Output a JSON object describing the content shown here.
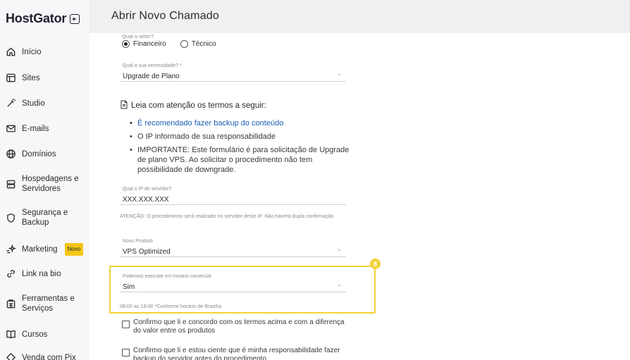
{
  "brand": {
    "name": "HostGator"
  },
  "sidebar": {
    "items": [
      {
        "label": "Início",
        "icon": "home-icon"
      },
      {
        "label": "Sites",
        "icon": "browser-icon"
      },
      {
        "label": "Studio",
        "icon": "wand-icon"
      },
      {
        "label": "E-mails",
        "icon": "mail-icon"
      },
      {
        "label": "Domínios",
        "icon": "globe-icon"
      },
      {
        "label": "Hospedagens e Servidores",
        "icon": "server-icon"
      },
      {
        "label": "Segurança e Backup",
        "icon": "shield-icon"
      },
      {
        "label": "Marketing",
        "icon": "sparkle-icon",
        "badge": "Novo"
      },
      {
        "label": "Link na bio",
        "icon": "link-icon"
      },
      {
        "label": "Ferramentas e Serviços",
        "icon": "tools-icon"
      },
      {
        "label": "Cursos",
        "icon": "book-icon"
      },
      {
        "label": "Venda com Pix",
        "icon": "pix-icon"
      }
    ]
  },
  "header": {
    "title": "Abrir Novo Chamado"
  },
  "form": {
    "sector_label": "Qual o setor?",
    "sector_options": [
      "Financeiro",
      "Técnico"
    ],
    "sector_selected": "Financeiro",
    "need_label": "Qual a sua necessidade? *",
    "need_value": "Upgrade de Plano",
    "terms_title": "Leia com atenção os termos a seguir:",
    "terms": [
      "É recomendado fazer backup do conteúdo",
      "O IP informado de sua responsabilidade",
      "IMPORTANTE: Este formulário é para solicitação de Upgrade de plano VPS. Ao solicitar o procedimento não tem possibilidade de downgrade."
    ],
    "ip_label": "Qual o IP do servidor?",
    "ip_value": "XXX.XXX.XXX",
    "ip_note": "ATENÇÃO: O procedimento será realizado no servidor deste IP. Não haverá dupla confirmação",
    "product_label": "Novo Produto",
    "product_value": "VPS Optimized",
    "business_hours_label": "Podemos executar em horário comercial",
    "business_hours_value": "Sim",
    "business_hours_note": "08:00 as 18:00 *Conforme horário de Brasília",
    "step_number": "8",
    "confirm_1": "Confirmo que li e concordo com os termos acima e com a diferença do valor entre os produtos",
    "confirm_2": "Confirmo que li e estou ciente que é minha responsabilidade fazer backup do servidor antes do procedimento"
  },
  "colors": {
    "highlight": "#f2d23a",
    "link": "#1a5fb4",
    "badge": "#f5c518"
  }
}
